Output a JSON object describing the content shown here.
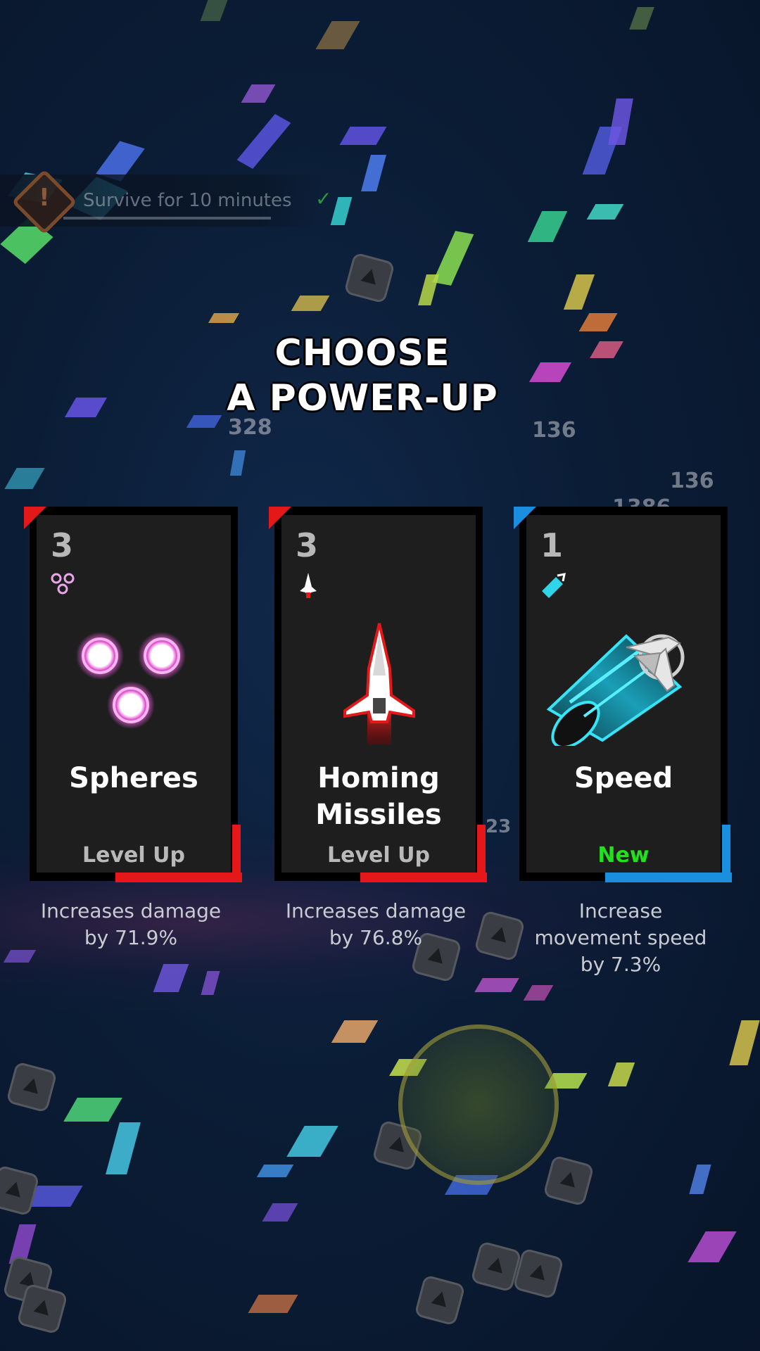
{
  "quest": {
    "text": "Survive for 10 minutes",
    "icon": "warning-icon",
    "check_icon": "checkmark-icon"
  },
  "title": {
    "line1": "CHOOSE",
    "line2": "A POWER-UP"
  },
  "floating_numbers": [
    "328",
    "136",
    "136",
    "1386",
    "23"
  ],
  "cards": [
    {
      "level": "3",
      "name": "Spheres",
      "status": "Level Up",
      "description": [
        "Increases damage",
        "by 71.9%"
      ],
      "icon": "spheres-icon",
      "accent_color": "#e41818"
    },
    {
      "level": "3",
      "name_line1": "Homing",
      "name_line2": "Missiles",
      "status": "Level Up",
      "description": [
        "Increases damage",
        "by 76.8%"
      ],
      "icon": "homing-missile-icon",
      "accent_color": "#e41818"
    },
    {
      "level": "1",
      "name": "Speed",
      "status": "New",
      "description": [
        "Increase",
        "movement speed",
        "by 7.3%"
      ],
      "icon": "speed-thruster-icon",
      "accent_color": "#1a8fe0",
      "status_color": "#22e01e"
    }
  ],
  "colors": {
    "background": "#0b1d36",
    "card_bg": "#1e1e1f",
    "red_accent": "#e41818",
    "blue_accent": "#1a8fe0",
    "new_green": "#22e01e"
  }
}
